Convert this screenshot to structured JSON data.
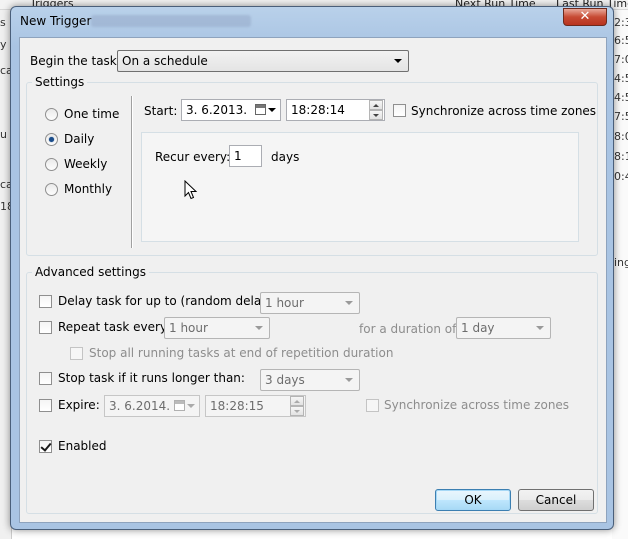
{
  "background": {
    "columns": [
      "Triggers",
      "Next Run Time",
      "Last Run Time"
    ],
    "right_fragments": [
      "2:3",
      "6:5",
      "7:0",
      "4:5",
      "4:5",
      "7:5",
      "8:0",
      "8:1",
      "0:4",
      "ing"
    ],
    "left_fragments": [
      "s",
      "y",
      "ca",
      "u",
      "ca",
      "18"
    ]
  },
  "dialog": {
    "title": "New Trigger",
    "close_glyph": "✕",
    "begin_label": "Begin the task:",
    "begin_value": "On a schedule",
    "settings": {
      "title": "Settings",
      "schedule_options": [
        "One time",
        "Daily",
        "Weekly",
        "Monthly"
      ],
      "selected_option": "Daily",
      "start_label": "Start:",
      "start_date": "3.  6.2013.",
      "start_time": "18:28:14",
      "sync_label": "Synchronize across time zones",
      "recur_label": "Recur every:",
      "recur_value": "1",
      "recur_unit": "days"
    },
    "advanced": {
      "title": "Advanced settings",
      "delay_label": "Delay task for up to (random delay):",
      "delay_value": "1 hour",
      "repeat_label": "Repeat task every:",
      "repeat_value": "1 hour",
      "duration_label": "for a duration of:",
      "duration_value": "1 day",
      "stop_running_label": "Stop all running tasks at end of repetition duration",
      "stop_longer_label": "Stop task if it runs longer than:",
      "stop_longer_value": "3 days",
      "expire_label": "Expire:",
      "expire_date": "3.  6.2014.",
      "expire_time": "18:28:15",
      "expire_sync_label": "Synchronize across time zones",
      "enabled_label": "Enabled"
    },
    "buttons": {
      "ok": "OK",
      "cancel": "Cancel"
    }
  }
}
